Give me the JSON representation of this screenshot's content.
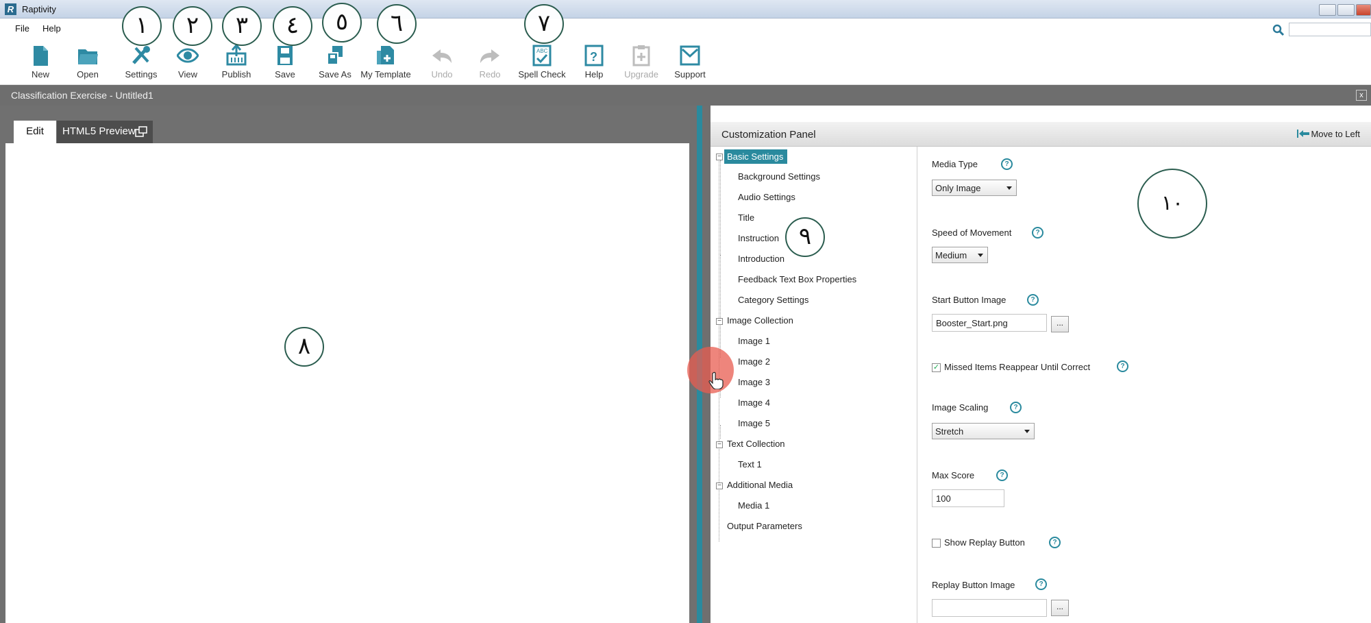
{
  "window": {
    "app_name": "Raptivity",
    "logo_letter": "R"
  },
  "menu": {
    "items": [
      "File",
      "Help"
    ]
  },
  "toolbar": {
    "items": [
      {
        "label": "New",
        "icon": "new-file-icon",
        "enabled": true
      },
      {
        "label": "Open",
        "icon": "open-folder-icon",
        "enabled": true
      },
      {
        "label": "Settings",
        "icon": "settings-tools-icon",
        "enabled": true
      },
      {
        "label": "View",
        "icon": "eye-icon",
        "enabled": true
      },
      {
        "label": "Publish",
        "icon": "publish-icon",
        "enabled": true
      },
      {
        "label": "Save",
        "icon": "save-icon",
        "enabled": true
      },
      {
        "label": "Save As",
        "icon": "save-as-icon",
        "enabled": true
      },
      {
        "label": "My Template",
        "icon": "my-template-icon",
        "enabled": true
      },
      {
        "label": "Undo",
        "icon": "undo-icon",
        "enabled": false
      },
      {
        "label": "Redo",
        "icon": "redo-icon",
        "enabled": false
      },
      {
        "label": "Spell Check",
        "icon": "spell-check-icon",
        "enabled": true
      },
      {
        "label": "Help",
        "icon": "help-icon",
        "enabled": true
      },
      {
        "label": "Upgrade",
        "icon": "upgrade-icon",
        "enabled": false
      },
      {
        "label": "Support",
        "icon": "support-mail-icon",
        "enabled": true
      }
    ]
  },
  "badges": [
    "١",
    "٢",
    "٣",
    "٤",
    "٥",
    "٦",
    "٧",
    "٨",
    "٩",
    "١٠"
  ],
  "document": {
    "title": "Classification Exercise - Untitled1",
    "close_label": "x"
  },
  "tabs": {
    "edit": "Edit",
    "preview": "HTML5 Preview"
  },
  "panel": {
    "title": "Customization Panel",
    "move_label": "Move to Left"
  },
  "tree": {
    "basic_settings": "Basic Settings",
    "basic_children": [
      "Background Settings",
      "Audio Settings",
      "Title",
      "Instruction",
      "Introduction",
      "Feedback Text Box Properties",
      "Category Settings"
    ],
    "image_collection": "Image Collection",
    "image_children": [
      "Image 1",
      "Image 2",
      "Image 3",
      "Image 4",
      "Image 5"
    ],
    "text_collection": "Text Collection",
    "text_children": [
      "Text 1"
    ],
    "additional_media": "Additional Media",
    "media_children": [
      "Media 1"
    ],
    "output_parameters": "Output Parameters"
  },
  "props": {
    "media_type_label": "Media Type",
    "media_type_value": "Only Image",
    "speed_label": "Speed of Movement",
    "speed_value": "Medium",
    "start_image_label": "Start Button Image",
    "start_image_value": "Booster_Start.png",
    "browse_label": "...",
    "missed_label": "Missed Items Reappear Until Correct",
    "missed_checked": true,
    "scaling_label": "Image Scaling",
    "scaling_value": "Stretch",
    "max_score_label": "Max Score",
    "max_score_value": "100",
    "replay_label": "Show Replay Button",
    "replay_checked": false,
    "replay_image_label": "Replay Button Image",
    "replay_image_value": ""
  },
  "colors": {
    "accent": "#2a8a9e",
    "badge_border": "#2b5d4f",
    "workspace": "#707070"
  }
}
